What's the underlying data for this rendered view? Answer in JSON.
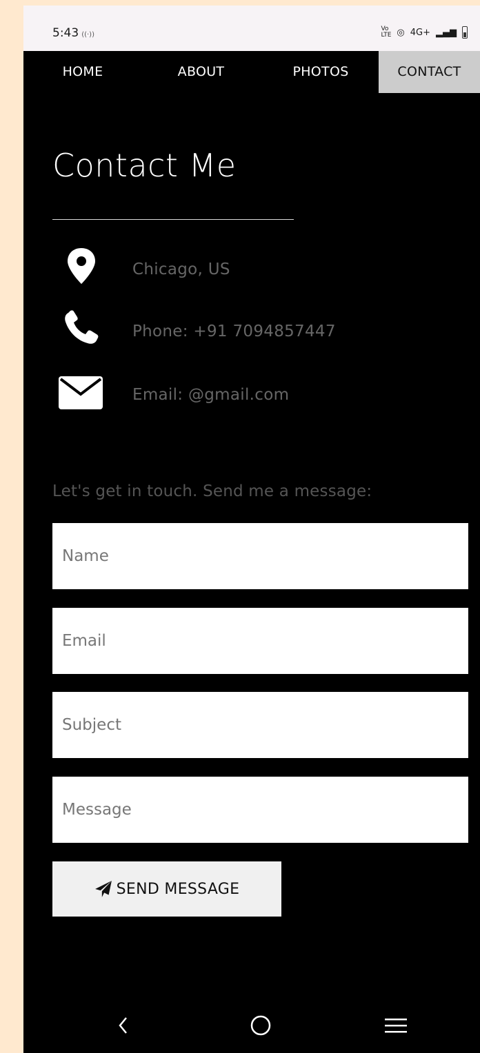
{
  "status_bar": {
    "time": "5:43",
    "network": "4G+"
  },
  "nav": {
    "items": [
      {
        "label": "HOME"
      },
      {
        "label": "ABOUT"
      },
      {
        "label": "PHOTOS"
      },
      {
        "label": "CONTACT"
      }
    ],
    "active": "CONTACT"
  },
  "contact": {
    "title": "Contact Me",
    "location": "Chicago, US",
    "phone": "Phone: +91 7094857447",
    "email": "Email: @gmail.com"
  },
  "form": {
    "prompt": "Let's get in touch. Send me a message:",
    "name_placeholder": "Name",
    "email_placeholder": "Email",
    "subject_placeholder": "Subject",
    "message_placeholder": "Message",
    "send_label": "SEND MESSAGE"
  },
  "colors": {
    "background": "#000000",
    "active_tab": "#cccccc",
    "page_outer": "#ffe9cf"
  },
  "icons": [
    "map-marker-icon",
    "phone-icon",
    "envelope-icon",
    "paper-plane-icon",
    "back-icon",
    "home-icon",
    "recents-icon"
  ]
}
